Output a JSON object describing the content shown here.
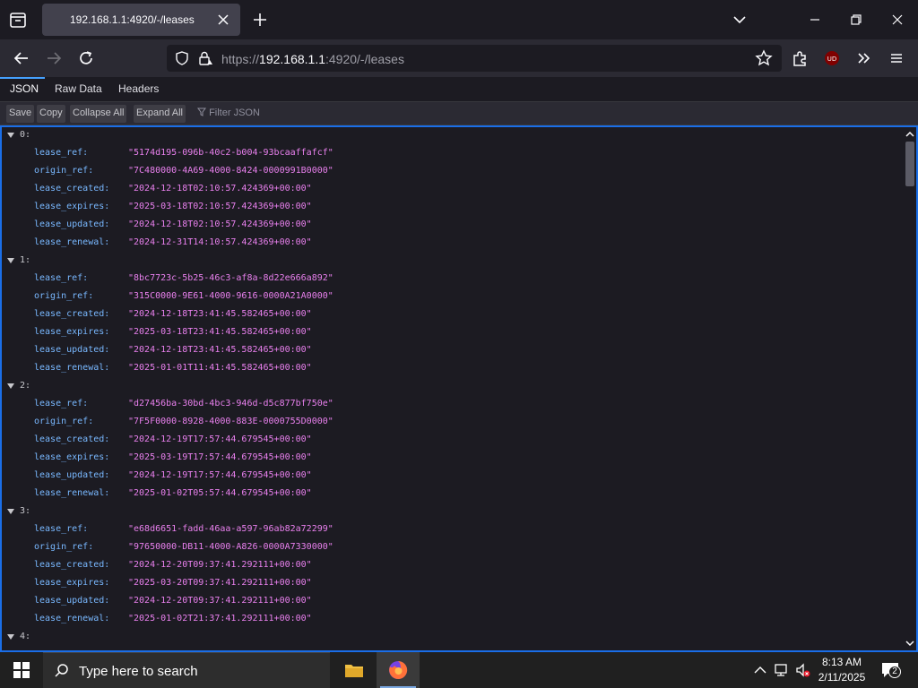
{
  "browser": {
    "tab_title": "192.168.1.1:4920/-/leases",
    "url_scheme": "https://",
    "url_host": "192.168.1.1",
    "url_rest": ":4920/-/leases"
  },
  "viewer_tabs": [
    "JSON",
    "Raw Data",
    "Headers"
  ],
  "toolbar": {
    "save": "Save",
    "copy": "Copy",
    "collapse_all": "Collapse All",
    "expand_all": "Expand All",
    "filter_placeholder": "Filter JSON"
  },
  "leases": [
    {
      "index": "0:",
      "fields": [
        [
          "lease_ref:",
          "\"5174d195-096b-40c2-b004-93bcaaffafcf\""
        ],
        [
          "origin_ref:",
          "\"7C480000-4A69-4000-8424-0000991B0000\""
        ],
        [
          "lease_created:",
          "\"2024-12-18T02:10:57.424369+00:00\""
        ],
        [
          "lease_expires:",
          "\"2025-03-18T02:10:57.424369+00:00\""
        ],
        [
          "lease_updated:",
          "\"2024-12-18T02:10:57.424369+00:00\""
        ],
        [
          "lease_renewal:",
          "\"2024-12-31T14:10:57.424369+00:00\""
        ]
      ]
    },
    {
      "index": "1:",
      "fields": [
        [
          "lease_ref:",
          "\"8bc7723c-5b25-46c3-af8a-8d22e666a892\""
        ],
        [
          "origin_ref:",
          "\"315C0000-9E61-4000-9616-0000A21A0000\""
        ],
        [
          "lease_created:",
          "\"2024-12-18T23:41:45.582465+00:00\""
        ],
        [
          "lease_expires:",
          "\"2025-03-18T23:41:45.582465+00:00\""
        ],
        [
          "lease_updated:",
          "\"2024-12-18T23:41:45.582465+00:00\""
        ],
        [
          "lease_renewal:",
          "\"2025-01-01T11:41:45.582465+00:00\""
        ]
      ]
    },
    {
      "index": "2:",
      "fields": [
        [
          "lease_ref:",
          "\"d27456ba-30bd-4bc3-946d-d5c877bf750e\""
        ],
        [
          "origin_ref:",
          "\"7F5F0000-8928-4000-883E-0000755D0000\""
        ],
        [
          "lease_created:",
          "\"2024-12-19T17:57:44.679545+00:00\""
        ],
        [
          "lease_expires:",
          "\"2025-03-19T17:57:44.679545+00:00\""
        ],
        [
          "lease_updated:",
          "\"2024-12-19T17:57:44.679545+00:00\""
        ],
        [
          "lease_renewal:",
          "\"2025-01-02T05:57:44.679545+00:00\""
        ]
      ]
    },
    {
      "index": "3:",
      "fields": [
        [
          "lease_ref:",
          "\"e68d6651-fadd-46aa-a597-96ab82a72299\""
        ],
        [
          "origin_ref:",
          "\"97650000-DB11-4000-A826-0000A7330000\""
        ],
        [
          "lease_created:",
          "\"2024-12-20T09:37:41.292111+00:00\""
        ],
        [
          "lease_expires:",
          "\"2025-03-20T09:37:41.292111+00:00\""
        ],
        [
          "lease_updated:",
          "\"2024-12-20T09:37:41.292111+00:00\""
        ],
        [
          "lease_renewal:",
          "\"2025-01-02T21:37:41.292111+00:00\""
        ]
      ]
    },
    {
      "index": "4:",
      "fields": []
    }
  ],
  "taskbar": {
    "search_placeholder": "Type here to search",
    "time": "8:13 AM",
    "date": "2/11/2025",
    "notification_count": "2"
  },
  "colors": {
    "accent": "#45a1ff",
    "key": "#79b8ff",
    "string": "#e980ee"
  }
}
